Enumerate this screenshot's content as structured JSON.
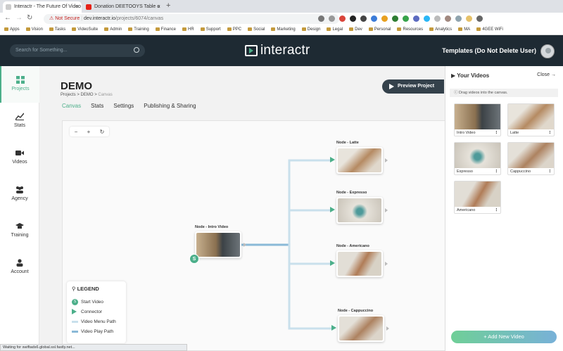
{
  "browser": {
    "tabs": [
      {
        "title": "Interactr - The Future Of Video",
        "active": true
      },
      {
        "title": "Donation DEETOOYS Table o",
        "active": false
      }
    ],
    "url_warning": "Not Secure",
    "url_host": "dev.interactr.io",
    "url_path": "/projects/6074/canvas",
    "bookmarks": [
      "Apps",
      "Vision",
      "Tasks",
      "VideoSuite",
      "Admin",
      "Training",
      "Finance",
      "HR",
      "Support",
      "PPC",
      "Social",
      "Marketing",
      "Design",
      "Legal",
      "Dev",
      "Personal",
      "Resources",
      "Analytics",
      "MA",
      "4GEE WiFi"
    ],
    "status_text": "Waiting for swiftads6.global.ssl.fastly.net..."
  },
  "header": {
    "search_placeholder": "Search for Something...",
    "logo": "interactr",
    "user": "Templates (Do Not Delete User)"
  },
  "sidebar": {
    "items": [
      {
        "label": "Projects",
        "icon": "grid-icon",
        "active": true
      },
      {
        "label": "Stats",
        "icon": "chart-icon",
        "active": false
      },
      {
        "label": "Videos",
        "icon": "video-camera-icon",
        "active": false
      },
      {
        "label": "Agency",
        "icon": "users-icon",
        "active": false
      },
      {
        "label": "Training",
        "icon": "graduation-cap-icon",
        "active": false
      },
      {
        "label": "Account",
        "icon": "user-icon",
        "active": false
      }
    ]
  },
  "project": {
    "title": "DEMO",
    "breadcrumb": {
      "root": "Projects",
      "sep": ">",
      "project": "DEMO",
      "current": "Canvas"
    },
    "tabs": [
      {
        "label": "Canvas",
        "active": true
      },
      {
        "label": "Stats",
        "active": false
      },
      {
        "label": "Settings",
        "active": false
      },
      {
        "label": "Publishing & Sharing",
        "active": false
      }
    ],
    "preview_label": "Preview Project"
  },
  "canvas": {
    "zoom": {
      "minus": "−",
      "plus": "+",
      "reset": "↻"
    },
    "nodes": [
      {
        "label": "Node - Intro Video",
        "start": true,
        "start_mark": "S"
      },
      {
        "label": "Node - Latte"
      },
      {
        "label": "Node - Expresso"
      },
      {
        "label": "Node - Americano"
      },
      {
        "label": "Node - Cappuccino"
      }
    ],
    "legend": {
      "title": "LEGEND",
      "items": [
        {
          "label": "Start Video",
          "mark": "S"
        },
        {
          "label": "Connector"
        },
        {
          "label": "Video Menu Path"
        },
        {
          "label": "Video Play Path"
        }
      ]
    },
    "colors": {
      "accent": "#4caf8a",
      "menu_path": "#c9e0ec",
      "play_path": "#8ab9d7"
    }
  },
  "panel": {
    "title": "Your Videos",
    "close": "Close →",
    "info": "Drag videos into the canvas.",
    "videos": [
      "Intro Video",
      "Latte",
      "Expresso",
      "Cappuccino",
      "Americano"
    ],
    "menu_glyph": "⋮",
    "add_label": "+ Add New Video"
  }
}
